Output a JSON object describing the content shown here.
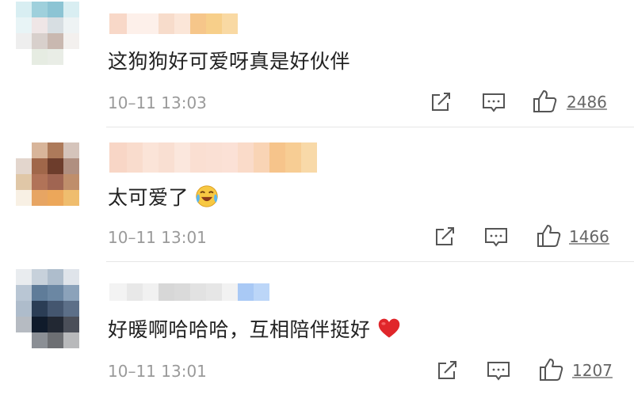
{
  "comments": [
    {
      "text": "这狗狗好可爱呀真是好伙伴",
      "time": "10–11 13:03",
      "likes": "2486",
      "emoji": ""
    },
    {
      "text": "太可爱了",
      "time": "10–11 13:01",
      "likes": "1466",
      "emoji": "laughing-crying-emoji"
    },
    {
      "text": "好暖啊哈哈哈，互相陪伴挺好",
      "time": "10–11 13:01",
      "likes": "1207",
      "emoji": "red-heart-emoji"
    }
  ],
  "colors": {
    "heart": "#e0262b",
    "divider": "#e6e6e6",
    "time": "#9a9a9a",
    "text": "#222222"
  }
}
